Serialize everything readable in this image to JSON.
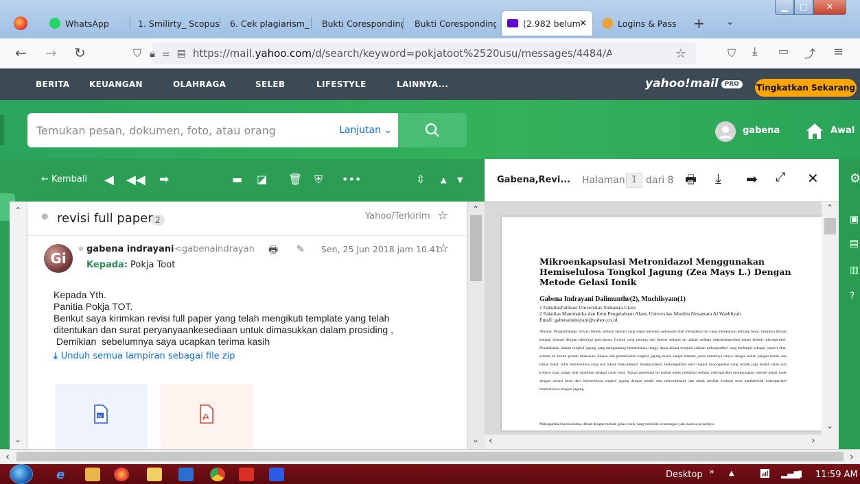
{
  "browser": {
    "tabs": [
      {
        "label": "WhatsApp",
        "icon": "whatsapp-icon",
        "color": "#25d366"
      },
      {
        "label": "1. Smilirty_ Scopus",
        "icon": "page-icon",
        "color": ""
      },
      {
        "label": "6. Cek plagiarism_",
        "icon": "page-icon",
        "color": ""
      },
      {
        "label": "Bukti Coresponding",
        "icon": "page-icon",
        "color": ""
      },
      {
        "label": "Bukti Coresponding",
        "icon": "page-icon",
        "color": ""
      },
      {
        "label": "(2.982 belum",
        "icon": "mail-icon",
        "color": "#6001d2"
      },
      {
        "label": "Logins & Pass",
        "icon": "circle-icon",
        "color": "#e8a23b"
      }
    ],
    "url_prefix": "https://mail.",
    "url_domain": "yahoo.com",
    "url_path": "/d/search/keyword=pokjatoot%2520usu/messages/4484/A"
  },
  "yahoo_nav": {
    "items": [
      "BERITA",
      "KEUANGAN",
      "OLAHRAGA",
      "SELEB",
      "LIFESTYLE",
      "LAINNYA..."
    ],
    "logo": "yahoo!mail",
    "pro_badge": "PRO",
    "upgrade_label": "Tingkatkan Sekarang"
  },
  "header": {
    "search_placeholder": "Temukan pesan, dokumen, foto, atau orang",
    "advanced_label": "Lanjutan ⌄",
    "username": "gabena",
    "home_label": "Awal"
  },
  "message_toolbar": {
    "back_label": "← Kembali"
  },
  "thread": {
    "subject": "revisi full paper",
    "count": "2",
    "folder": "Yahoo/Terkirim"
  },
  "message": {
    "sender_name": "gabena indrayani",
    "sender_email": "<gabenaindrayan",
    "date": "Sen, 25 Jun 2018 jam 10.41",
    "to_label": "Kepada:",
    "to_name": "Pokja Toot",
    "avatar_letters": "Gi",
    "body": [
      "Kepada Yth.",
      "Panitia Pokja TOT.",
      "Berikut saya kirimkan revisi full paper yang telah mengikuti template yang telah",
      "ditentukan dan surat peryanyaankesediaan untuk dimasukkan dalam prosiding ,",
      " Demikian  sebelumnya saya ucapkan terima kasih"
    ],
    "download_all_label": "Unduh semua lampiran sebagai file zip"
  },
  "viewer": {
    "doc_title": "Gabena,Revi...",
    "page_label": "Halaman",
    "page_num": "1",
    "page_of": "dari 8"
  },
  "paper": {
    "title": "Mikroenkapsulasi Metronidazol Menggunakan Hemiselulosa Tongkol Jagung (Zea Mays L.) Dengan Metode Gelasi Ionik",
    "authors": "Gabena Indrayani Dalimunthe(2), Muchlisyam(1)",
    "affil1": "1 FakultasFarmasi Universitas Sumatera Utara",
    "affil2": "2 Fakultas Matematika dan Ilmu Pengetahuan Alam, Universitas Muslim Nusantara Al Washliyah",
    "email": "Email: gabenaindrayani@yahoo.co.id",
    "abstract": "Abstrak. Pengembangan inovasi bentuk sediaan farmasi yang dapat menunda pelepasan obat merupakan hal yang mempunyai peluang besar, misalnya bentuk sediaan farmasi dengan teknologi penyalutan. Contoh yang penting dari bentuk sediaan ini adalah sediaan mikroenkapsulasi dalam bentuk mikropartikel. Pemanfaatan limbah tongkol jagung yang mengandung hemiselulosa tinggi, dapat dibuat menjadi sediaan mikropartikel yang berfungsi sebagai (carier) obat, selama ini belum pernah dilakukan. Alasan lain pemanfaatan tongkol jagung masih sangat terbatas, pada umumnya hanya sebagai bahan pangan ternak dan bahan bakar. Sifat hemiselulosa yang non toksik mukoadhesif, biodegradabel, biokompatibel serta tingkat imunogenitas yang rendah juga adalah salah satu kriteria yang sangat baik dijadikan sebagai carier obat. Tujuan penelitian ini adalah untuk membuat sediaan mikropartikel menggunakan metode gelasi ionik dengan variasi berat dari hemiselulosa tongkol jagung dengan model obat metronidazole dan untuk melihat evaluasi serta karakteristik mikropartikel hemiselulosa tongkol jagung.",
    "abstract2": "Mikropartikel hemiselulosa dibuat dengan metode gelasi ionik yang memiliki keuntungan yaitu karena prosesnya"
  },
  "taskbar": {
    "desktop_label": "Desktop",
    "time": "11:59 AM"
  }
}
